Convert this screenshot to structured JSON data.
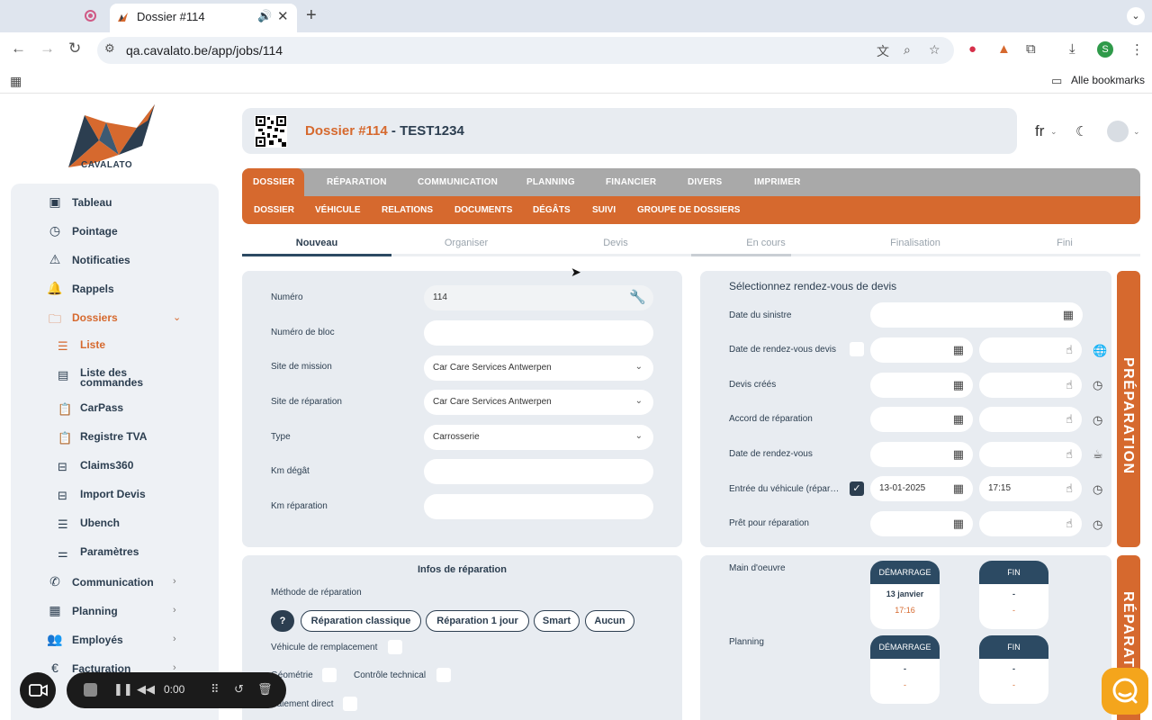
{
  "browser": {
    "tab_title": "Dossier #114",
    "url": "qa.cavalato.be/app/jobs/114",
    "bookmarks_label": "Alle bookmarks",
    "profile_initial": "S"
  },
  "app": {
    "logo_text": "CAVALATO",
    "lang": "fr",
    "dossier_number": "Dossier #114",
    "separator": " - ",
    "dossier_name": "TEST1234"
  },
  "sidebar": {
    "items": [
      {
        "label": "Tableau",
        "icon": "grid-icon"
      },
      {
        "label": "Pointage",
        "icon": "clock-icon"
      },
      {
        "label": "Notificaties",
        "icon": "warning-icon"
      },
      {
        "label": "Rappels",
        "icon": "bell-icon"
      },
      {
        "label": "Dossiers",
        "icon": "folder-icon"
      }
    ],
    "subitems": [
      {
        "label": "Liste"
      },
      {
        "label": "Liste des commandes"
      },
      {
        "label": "CarPass"
      },
      {
        "label": "Registre TVA"
      },
      {
        "label": "Claims360"
      },
      {
        "label": "Import Devis"
      },
      {
        "label": "Ubench"
      },
      {
        "label": "Paramètres"
      }
    ],
    "more": [
      {
        "label": "Communication"
      },
      {
        "label": "Planning"
      },
      {
        "label": "Employés"
      },
      {
        "label": "Facturation"
      }
    ]
  },
  "tabs_top": [
    "DOSSIER",
    "RÉPARATION",
    "COMMUNICATION",
    "PLANNING",
    "FINANCIER",
    "DIVERS",
    "IMPRIMER"
  ],
  "tabs_sub": [
    "DOSSIER",
    "VÉHICULE",
    "RELATIONS",
    "DOCUMENTS",
    "DÉGÂTS",
    "SUIVI",
    "GROUPE DE DOSSIERS"
  ],
  "steps": [
    "Nouveau",
    "Organiser",
    "Devis",
    "En cours",
    "Finalisation",
    "Fini"
  ],
  "form": {
    "numero_label": "Numéro",
    "numero_value": "114",
    "bloc_label": "Numéro de bloc",
    "mission_label": "Site de mission",
    "mission_value": "Car Care Services Antwerpen",
    "repar_label": "Site de réparation",
    "repar_value": "Car Care Services Antwerpen",
    "type_label": "Type",
    "type_value": "Carrosserie",
    "km_degat_label": "Km dégât",
    "km_repar_label": "Km réparation"
  },
  "rdv": {
    "title": "Sélectionnez rendez-vous de devis",
    "rows": [
      {
        "label": "Date du sinistre"
      },
      {
        "label": "Date de rendez-vous devis"
      },
      {
        "label": "Devis créés"
      },
      {
        "label": "Accord de réparation"
      },
      {
        "label": "Date de rendez-vous"
      },
      {
        "label": "Entrée du véhicule (répar…",
        "date": "13-01-2025",
        "time": "17:15"
      },
      {
        "label": "Prêt pour réparation"
      }
    ],
    "band": "PRÉPARATION"
  },
  "infos": {
    "title": "Infos de réparation",
    "methode_label": "Méthode de réparation",
    "q": "?",
    "methods": [
      "Réparation classique",
      "Réparation 1 jour",
      "Smart",
      "Aucun"
    ],
    "vehicule_label": "Véhicule de remplacement",
    "geometrie_label": "Géométrie",
    "controle_label": "Contrôle technical",
    "paiement_label": "Paiement direct"
  },
  "reparation": {
    "main_label": "Main d'oeuvre",
    "planning_label": "Planning",
    "start_label": "DÉMARRAGE",
    "end_label": "FIN",
    "main_start_date": "13 janvier",
    "main_start_time": "17:16",
    "dash": "-",
    "band": "RÉPARATION"
  },
  "recorder": {
    "time": "0:00"
  },
  "colors": {
    "accent": "#d6692e",
    "navy": "#2c3e50",
    "panel": "#e8ecf1"
  }
}
